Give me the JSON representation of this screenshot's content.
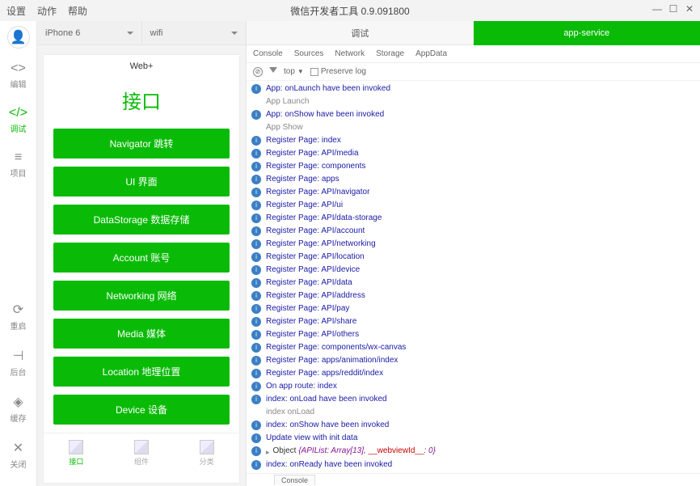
{
  "menu": {
    "settings": "设置",
    "actions": "动作",
    "help": "帮助"
  },
  "window": {
    "title": "微信开发者工具 0.9.091800"
  },
  "rail": {
    "edit": "编辑",
    "debug": "调试",
    "project": "项目",
    "restart": "重启",
    "background": "后台",
    "cache": "缓存",
    "close": "关闭"
  },
  "device": {
    "model": "iPhone 6",
    "network": "wifi"
  },
  "phone": {
    "header": "Web+",
    "title": "接口",
    "buttons": [
      "Navigator 跳转",
      "UI 界面",
      "DataStorage 数据存储",
      "Account 账号",
      "Networking 网络",
      "Media 媒体",
      "Location 地理位置",
      "Device 设备"
    ],
    "tabs": [
      "接口",
      "组件",
      "分类"
    ]
  },
  "tabs": {
    "debug": "调试",
    "app": "app-service"
  },
  "subtabs": [
    "Console",
    "Sources",
    "Network",
    "Storage",
    "AppData"
  ],
  "ctl": {
    "context": "top",
    "preserve": "Preserve log"
  },
  "chart_data": null,
  "log": [
    {
      "b": "info",
      "t": "App: onLaunch have been invoked"
    },
    {
      "b": "none",
      "t": "App Launch"
    },
    {
      "b": "info",
      "t": "App: onShow have been invoked"
    },
    {
      "b": "none",
      "t": "App Show"
    },
    {
      "b": "info",
      "t": "Register Page: index"
    },
    {
      "b": "info",
      "t": "Register Page: API/media"
    },
    {
      "b": "info",
      "t": "Register Page: components"
    },
    {
      "b": "info",
      "t": "Register Page: apps"
    },
    {
      "b": "info",
      "t": "Register Page: API/navigator"
    },
    {
      "b": "info",
      "t": "Register Page: API/ui"
    },
    {
      "b": "info",
      "t": "Register Page: API/data-storage"
    },
    {
      "b": "info",
      "t": "Register Page: API/account"
    },
    {
      "b": "info",
      "t": "Register Page: API/networking"
    },
    {
      "b": "info",
      "t": "Register Page: API/location"
    },
    {
      "b": "info",
      "t": "Register Page: API/device"
    },
    {
      "b": "info",
      "t": "Register Page: API/data"
    },
    {
      "b": "info",
      "t": "Register Page: API/address"
    },
    {
      "b": "info",
      "t": "Register Page: API/pay"
    },
    {
      "b": "info",
      "t": "Register Page: API/share"
    },
    {
      "b": "info",
      "t": "Register Page: API/others"
    },
    {
      "b": "info",
      "t": "Register Page: components/wx-canvas"
    },
    {
      "b": "info",
      "t": "Register Page: apps/animation/index"
    },
    {
      "b": "info",
      "t": "Register Page: apps/reddit/index"
    },
    {
      "b": "info",
      "t": "On app route: index"
    },
    {
      "b": "info",
      "t": "index: onLoad have been invoked"
    },
    {
      "b": "none",
      "t": "index onLoad"
    },
    {
      "b": "info",
      "t": "index: onShow have been invoked"
    },
    {
      "b": "info",
      "t": "Update view with init data"
    },
    {
      "b": "info",
      "obj": true
    },
    {
      "b": "info",
      "t": "index: onReady have been invoked"
    }
  ],
  "objline": {
    "prefix": "Object",
    "body": "{APIList: Array[13], ",
    "key": "__webviewId__",
    "val": ": 0}"
  },
  "bottom": {
    "console": "Console"
  }
}
